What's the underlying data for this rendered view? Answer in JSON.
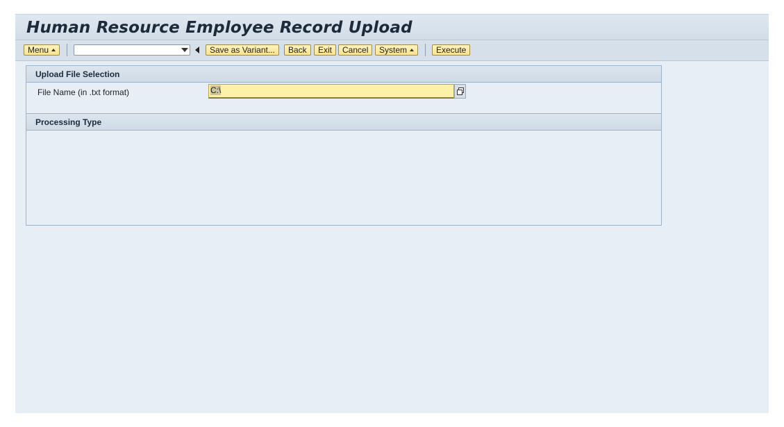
{
  "window": {
    "title": "Human Resource Employee Record Upload"
  },
  "toolbar": {
    "menu_label": "Menu",
    "command_field_value": "",
    "save_variant_label": "Save as Variant...",
    "back_label": "Back",
    "exit_label": "Exit",
    "cancel_label": "Cancel",
    "system_label": "System",
    "execute_label": "Execute"
  },
  "upload_section": {
    "title": "Upload File Selection",
    "file_name_label": "File Name (in .txt format)",
    "file_name_value": "C:\\"
  },
  "processing_section": {
    "title": "Processing Type"
  },
  "colors": {
    "button_bg": "#fbe38c",
    "input_bg": "#fdf0a8",
    "panel_bg": "#e8eef5",
    "header_bg": "#d5e0eb"
  }
}
